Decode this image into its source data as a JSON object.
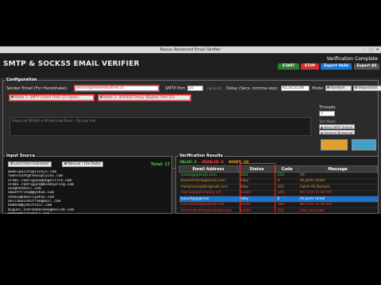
{
  "window": {
    "title": "Nexus Advanced Email Verifier",
    "ctl_min": "–",
    "ctl_max": "▢",
    "ctl_close": "✕"
  },
  "header": {
    "app_title": "SMTP & SOCKS5 EMAIL VERIFIER",
    "status": "Verification Complete",
    "buttons": {
      "start": "START",
      "stop": "STOP",
      "export_valid": "Export Valid",
      "export_all": "Export All"
    }
  },
  "config": {
    "label": "Configuration",
    "sender_label": "Sender Email (For Handshake):",
    "sender_value": "service@mikeindustries.co",
    "smtp_port_label": "SMTP Port:",
    "smtp_port_value": "25",
    "ignored_label": "(Ignored)",
    "delay_label": "Delay (Secs, comma-sep):",
    "delay_value": "45,50,55,60",
    "mode_label": "Mode:",
    "mode_random": "Random",
    "mode_sequential": "Sequential",
    "mode1": "Mode 1: SMTP Direct (Port 25 Open)",
    "mode2": "Mode 2: SOCKS5 Proxy (Bypass Port 25)",
    "threads_label": "Threads:",
    "threads_value": "1",
    "proxy_placeholder": "Proxy List (IP:Port or IP:Port:User:Pass) - One per line:",
    "test_mode_label": "Test Mode:",
    "strict_smtp": "Strict SMTP (Email)",
    "general_browsing": "General (Browsing)"
  },
  "input_source": {
    "label": "Input Source",
    "load_button": "Load from Extractor",
    "manual_button": "Manual / File Paste",
    "total": "Total: 17",
    "emails": [
      "modelpoints@livejo.com",
      "fwenrosht@reeal@lycos.com",
      "nromi.rodriguez@angelfire.com",
      "nromi.rodriguez@mindspring.com",
      "xxx@hotmail.com",
      "adoetfriko@@yahoo.com",
      "shobi@babelsyahoo.com",
      "anilawalomitraegmail.com",
      "bambam@jekitsail.com",
      "miguel.cherkobalbeegmeclub.com",
      "bmkk@@holbumail.net",
      "ningarmbiberg@yfoot.com",
      "mobilesolutionsanttech.net"
    ]
  },
  "results": {
    "label": "Verification Results",
    "valid": "VALID: 2",
    "invalid": "INVALID: 6",
    "risky": "RISKY: 10",
    "columns": {
      "email": "Email Address",
      "status": "Status",
      "code": "Code",
      "message": "Message"
    },
    "rows": [
      {
        "email": "redmp@@livejo.com",
        "status": "Valid",
        "code": "250",
        "message": "OK"
      },
      {
        "email": "boycemhemp@lycos.com",
        "status": "Risky",
        "code": "0",
        "message": "All ports failed"
      },
      {
        "email": "matejmark@tbrighnet.com",
        "status": "Risky",
        "code": "250",
        "message": "Catch-All Domain"
      },
      {
        "email": "mamalpa@taxiplop.net",
        "status": "Invalid",
        "code": "DNS",
        "message": "MX Error or No MX"
      },
      {
        "email": "lueumlp@@mail",
        "status": "Risky",
        "code": "0",
        "message": "All ports failed"
      },
      {
        "email": "mamaltyteb@tashop.net",
        "status": "Invalid",
        "code": "DNS",
        "message": "MX Error or No MX"
      },
      {
        "email": "cinimmbrother@hotmail.com",
        "status": "Invalid",
        "code": "550",
        "message": "User unknown"
      }
    ]
  },
  "colors": {
    "start": "#2e7d32",
    "stop": "#d32f2f",
    "export_valid": "#1976d2",
    "export_all": "#555555",
    "valid": "#3fd13f",
    "invalid": "#ff3b3b",
    "risky": "#f0a020"
  }
}
